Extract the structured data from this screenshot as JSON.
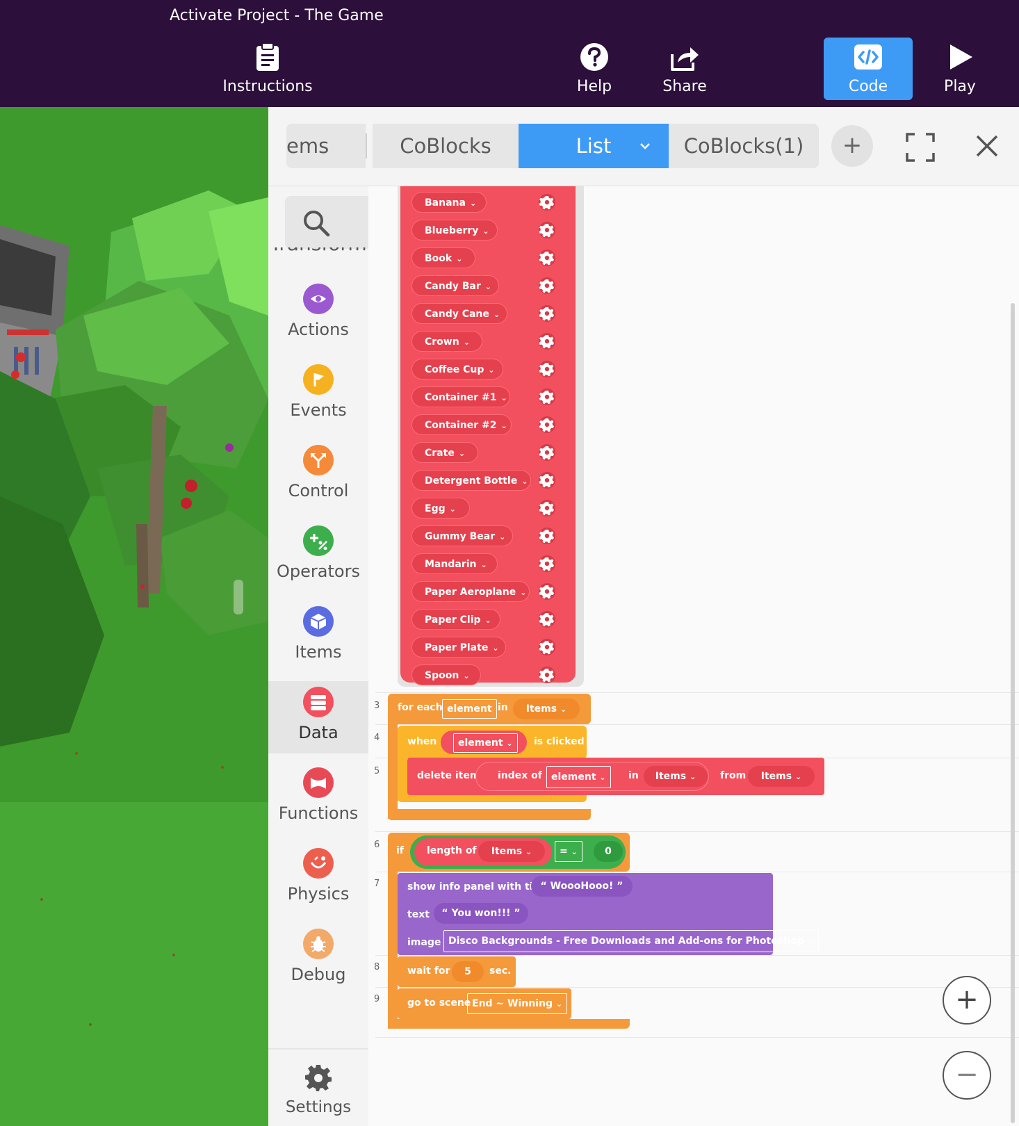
{
  "app": {
    "title": "Activate Project - The Game"
  },
  "toolbar": {
    "instructions": "Instructions",
    "help": "Help",
    "share": "Share",
    "code": "Code",
    "play": "Play"
  },
  "tabs": {
    "items_partial": "ems",
    "coblocks": "CoBlocks",
    "list": "List",
    "coblocks1": "CoBlocks(1)",
    "add": "+"
  },
  "palette": {
    "transform_partial": "Transform",
    "categories": [
      {
        "label": "Actions",
        "color": "#9b59d0",
        "icon": "eye-icon"
      },
      {
        "label": "Events",
        "color": "#f5b120",
        "icon": "flag-icon"
      },
      {
        "label": "Control",
        "color": "#f58a3a",
        "icon": "branch-icon"
      },
      {
        "label": "Operators",
        "color": "#3cae4c",
        "icon": "plus-percent-icon"
      },
      {
        "label": "Items",
        "color": "#5b6be0",
        "icon": "cube-icon"
      },
      {
        "label": "Data",
        "color": "#f2505e",
        "icon": "database-icon"
      },
      {
        "label": "Functions",
        "color": "#e84a55",
        "icon": "function-icon"
      },
      {
        "label": "Physics",
        "color": "#ec5f4f",
        "icon": "physics-icon"
      },
      {
        "label": "Debug",
        "color": "#f2a96a",
        "icon": "bug-icon"
      }
    ],
    "selected": "Data",
    "settings": "Settings"
  },
  "list_items": [
    "Banana",
    "Blueberry",
    "Book",
    "Candy Bar",
    "Candy Cane",
    "Crown",
    "Coffee Cup",
    "Container #1",
    "Container #2",
    "Crate",
    "Detergent Bottle",
    "Egg",
    "Gummy Bear",
    "Mandarin",
    "Paper Aeroplane",
    "Paper Clip",
    "Paper Plate",
    "Spoon"
  ],
  "code": {
    "lines": [
      "3",
      "4",
      "5",
      "6",
      "7",
      "8",
      "9"
    ],
    "for_each": {
      "kw": "for each",
      "var": "element",
      "in": "in",
      "list": "Items"
    },
    "when": {
      "kw": "when",
      "var": "element",
      "tail": "is clicked"
    },
    "delete": {
      "kw": "delete item",
      "index_of": "index of",
      "var": "element",
      "in": "in",
      "list1": "Items",
      "from": "from",
      "list2": "Items"
    },
    "if": {
      "kw": "if",
      "length_of": "length of",
      "list": "Items",
      "op": "=",
      "value": "0"
    },
    "info": {
      "kw": "show info panel with title",
      "title": "“ WoooHooo! ”",
      "text_kw": "text",
      "text": "“ You won!!! ”",
      "image_kw": "image",
      "image": "Disco Backgrounds - Free Downloads and Add-ons for Photoshop"
    },
    "wait": {
      "kw": "wait for",
      "value": "5",
      "unit": "sec."
    },
    "scene": {
      "kw": "go to scene",
      "value": "End ~ Winning"
    }
  },
  "zoom": {
    "in": "+",
    "out": "−"
  },
  "colors": {
    "topbar": "#2c0f3a",
    "accent": "#3d9bf5",
    "data_red": "#f2505e",
    "control_orange": "#f59a3a",
    "events_yellow": "#fbb52a",
    "operators_green": "#3cae4c",
    "actions_purple": "#9966cc"
  }
}
